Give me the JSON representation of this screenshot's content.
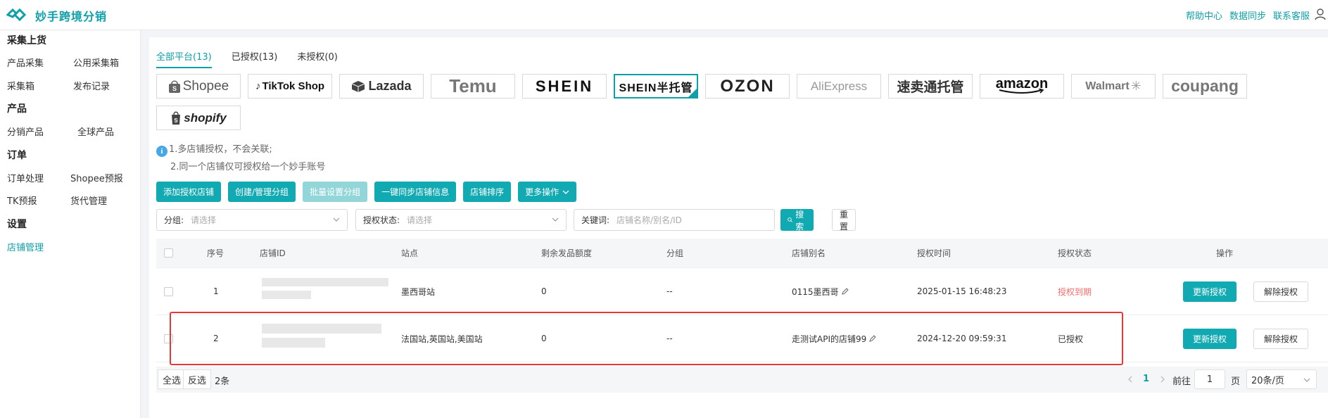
{
  "app": {
    "brand": "妙手跨境分销",
    "brand_color": "#0f9fa8",
    "top_links": [
      "帮助中心",
      "数据同步",
      "联系客服"
    ]
  },
  "sidebar": {
    "groups": [
      {
        "title": "采集上货",
        "items": [
          "产品采集",
          "公用采集箱",
          "采集箱",
          "发布记录"
        ]
      },
      {
        "title": "产品",
        "items": [
          "分销产品",
          "全球产品"
        ]
      },
      {
        "title": "订单",
        "items": [
          "订单处理",
          "Shopee预报",
          "TK预报",
          "货代管理"
        ]
      },
      {
        "title": "设置",
        "items": [
          "店铺管理"
        ]
      }
    ],
    "active_item": "店铺管理"
  },
  "tabs": [
    {
      "label": "全部平台(13)",
      "active": true
    },
    {
      "label": "已授权(13)",
      "active": false
    },
    {
      "label": "未授权(0)",
      "active": false
    }
  ],
  "platforms": [
    {
      "label": "Shopee",
      "color": "#555555",
      "icon": "shopee-bag-icon"
    },
    {
      "label": "TikTok Shop",
      "color": "#111111",
      "icon": "tiktok-note-icon"
    },
    {
      "label": "Lazada",
      "color": "#333333",
      "icon": "lazada-box-icon"
    },
    {
      "label": "Temu",
      "color": "#777777"
    },
    {
      "label": "SHEIN",
      "color": "#111111"
    },
    {
      "label": "SHEIN半托管",
      "color": "#111111",
      "selected": true
    },
    {
      "label": "OZON",
      "color": "#222222"
    },
    {
      "label": "AliExpress",
      "color": "#999999"
    },
    {
      "label": "速卖通托管",
      "color": "#333333"
    },
    {
      "label": "amazon",
      "color": "#111111"
    },
    {
      "label": "Walmart",
      "color": "#777777"
    },
    {
      "label": "coupang",
      "color": "#777777"
    },
    {
      "label": "shopify",
      "color": "#222222",
      "icon": "shopify-bag-icon"
    }
  ],
  "tips": [
    "1.多店铺授权，不会关联;",
    "2.同一个店铺仅可授权给一个妙手账号"
  ],
  "actions": [
    {
      "label": "添加授权店铺",
      "disabled": false
    },
    {
      "label": "创建/管理分组",
      "disabled": false
    },
    {
      "label": "批量设置分组",
      "disabled": true
    },
    {
      "label": "一键同步店铺信息",
      "disabled": false
    },
    {
      "label": "店铺排序",
      "disabled": false
    },
    {
      "label": "更多操作",
      "disabled": false
    }
  ],
  "filters": {
    "group": {
      "label": "分组:",
      "placeholder": "请选择"
    },
    "auth_status": {
      "label": "授权状态:",
      "placeholder": "请选择"
    },
    "keyword": {
      "label": "关键词:",
      "placeholder": "店铺名称/别名/ID"
    },
    "search_label": "搜索",
    "reset_label": "重置"
  },
  "table": {
    "columns": [
      "序号",
      "店铺ID",
      "站点",
      "剩余发品额度",
      "分组",
      "店铺别名",
      "授权时间",
      "授权状态",
      "操作"
    ],
    "rows": [
      {
        "index": "1",
        "site": "墨西哥站",
        "quota": "0",
        "group": "--",
        "alias": "0115墨西哥",
        "auth_time": "2025-01-15 16:48:23",
        "status": "授权到期",
        "status_type": "expired"
      },
      {
        "index": "2",
        "site": "法国站,英国站,美国站",
        "quota": "0",
        "group": "--",
        "alias": "走测试API的店铺99",
        "auth_time": "2024-12-20 09:59:31",
        "status": "已授权",
        "status_type": "ok"
      }
    ],
    "row_actions": {
      "renew": "更新授权",
      "unbind": "解除授权"
    }
  },
  "footer": {
    "select_all": "全选",
    "invert": "反选",
    "count": "2条",
    "current_page": "1",
    "goto_label": "前往",
    "page_input": "1",
    "page_suffix": "页",
    "page_size": "20条/页"
  }
}
